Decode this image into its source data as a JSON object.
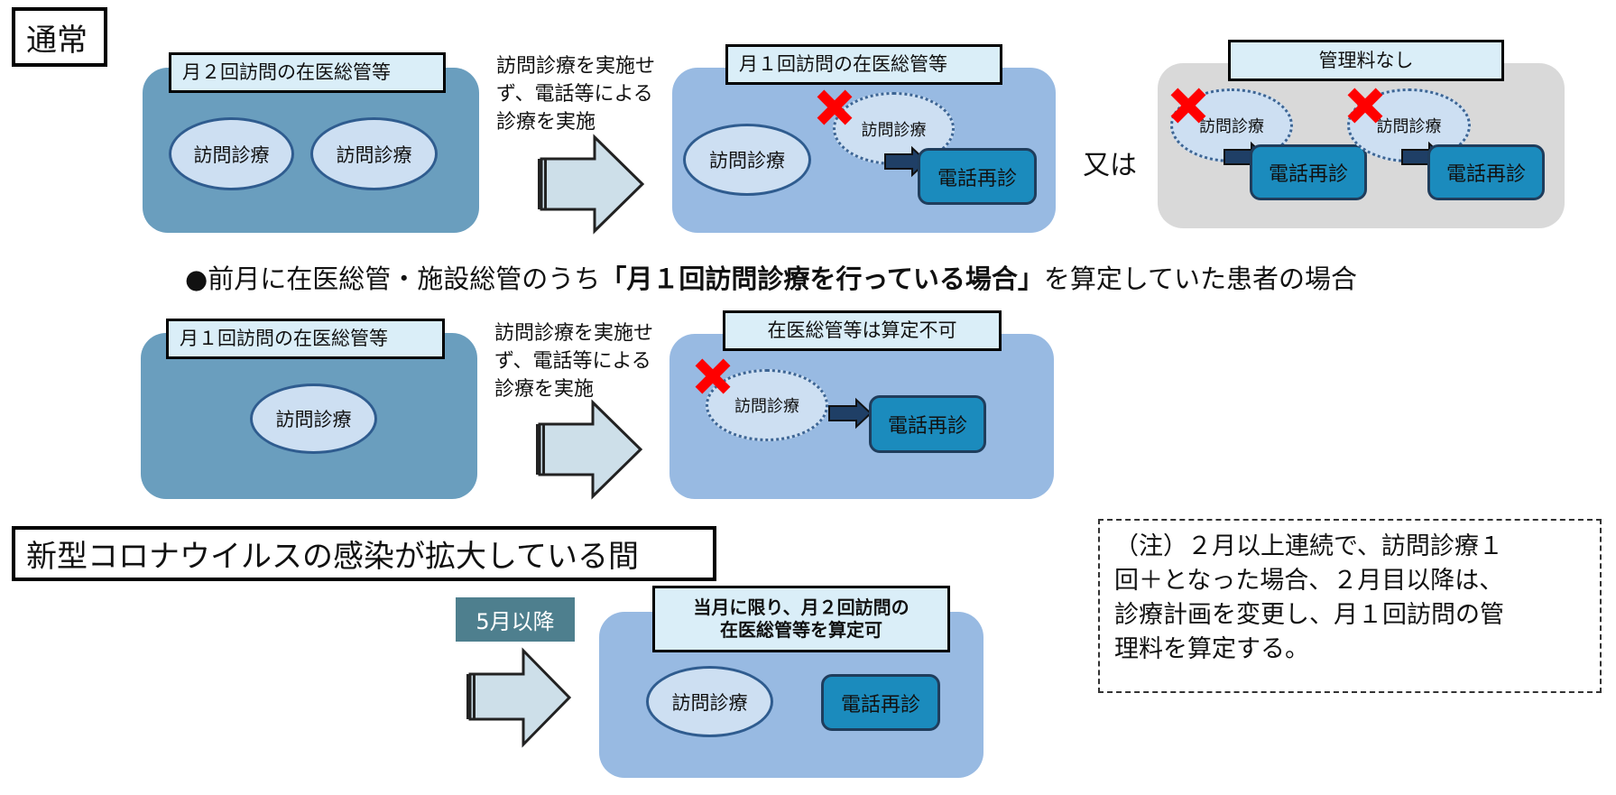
{
  "section_normal": {
    "title": "通常"
  },
  "row1": {
    "before": {
      "label": "月２回訪問の在医総管等",
      "visits": [
        "訪問診療",
        "訪問診療"
      ]
    },
    "transition_text": [
      "訪問診療を実施せ",
      "ず、電話等による",
      "診療を実施"
    ],
    "after_a": {
      "label": "月１回訪問の在医総管等",
      "visit": "訪問診療",
      "cancelled_visit": "訪問診療",
      "phone": "電話再診"
    },
    "or_text": "又は",
    "after_b": {
      "label": "管理料なし",
      "cancelled_visits": [
        "訪問診療",
        "訪問診療"
      ],
      "phones": [
        "電話再診",
        "電話再診"
      ]
    }
  },
  "bullet": {
    "prefix": "●前月に在医総管・施設総管のうち",
    "emphasis": "「月１回訪問診療を行っている場合」",
    "suffix": "を算定していた患者の場合"
  },
  "row2": {
    "before": {
      "label": "月１回訪問の在医総管等",
      "visit": "訪問診療"
    },
    "transition_text": [
      "訪問診療を実施せ",
      "ず、電話等による",
      "診療を実施"
    ],
    "after": {
      "label": "在医総管等は算定不可",
      "cancelled_visit": "訪問診療",
      "phone": "電話再診"
    }
  },
  "section_covid": {
    "title": "新型コロナウイルスの感染が拡大している間"
  },
  "row3": {
    "period": "5月以降",
    "after": {
      "label_lines": [
        "当月に限り、月２回訪問の",
        "在医総管等を算定可"
      ],
      "visit": "訪問診療",
      "phone": "電話再診"
    }
  },
  "note": {
    "lines": [
      "（注）２月以上連続で、訪問診療１",
      "回＋となった場合、２月目以降は、",
      "診療計画を変更し、月１回訪問の管",
      "理料を算定する。"
    ]
  },
  "icons": {
    "cancel": "red-x-mark",
    "transition": "right-block-arrow",
    "flow": "small-right-arrow"
  },
  "colors": {
    "panel_dark": "#6a9ebe",
    "panel_light": "#98bae2",
    "panel_gray": "#d9d9d9",
    "label_bg": "#daeef8",
    "visit_fill": "#cddff2",
    "phone_fill": "#1b8bbd",
    "cancel_red": "#ff0000",
    "period_tag": "#4e7f8e"
  }
}
